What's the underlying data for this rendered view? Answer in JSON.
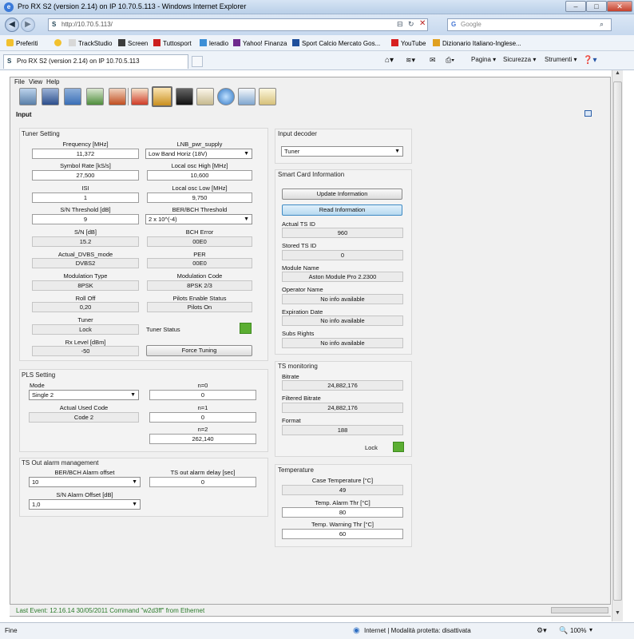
{
  "window": {
    "title": "Pro RX S2 (version 2.14) on IP 10.70.5.113 - Windows Internet Explorer"
  },
  "address": {
    "url": "http://10.70.5.113/",
    "search_placeholder": "Google"
  },
  "favorites": {
    "label": "Preferiti",
    "items": [
      "TrackStudio",
      "Screen",
      "Tuttosport",
      "leradio",
      "Yahoo! Finanza",
      "Sport Calcio Mercato Gos...",
      "YouTube",
      "Dizionario Italiano-Inglese..."
    ]
  },
  "tab": {
    "label": "Pro RX S2 (version 2.14) on IP 10.70.5.113"
  },
  "commands": {
    "page": "Pagina",
    "security": "Sicurezza",
    "tools": "Strumenti"
  },
  "app_menu": {
    "file": "File",
    "view": "View",
    "help": "Help"
  },
  "toolbar_icons": [
    "monitor-network-icon",
    "save-icon",
    "folder-icon",
    "download-icon",
    "upload-icon",
    "home-icon",
    "input-icon",
    "tv-icon",
    "clipboard-icon",
    "globe-user-icon",
    "checklist-icon",
    "edit-icon"
  ],
  "section_label": "Input",
  "tuner": {
    "title": "Tuner Setting",
    "frequency_label": "Frequency [MHz]",
    "frequency": "11,372",
    "lnb_label": "LNB_pwr_supply",
    "lnb": "Low Band Horiz (18V)",
    "symbol_rate_label": "Symbol Rate [kS/s]",
    "symbol_rate": "27,500",
    "lo_high_label": "Local osc High [MHz]",
    "lo_high": "10,600",
    "isi_label": "ISI",
    "isi": "1",
    "lo_low_label": "Local osc Low [MHz]",
    "lo_low": "9,750",
    "sn_threshold_label": "S/N Threshold [dB]",
    "sn_threshold": "9",
    "ber_threshold_label": "BER/BCH Threshold",
    "ber_threshold": "2 x 10^(-4)",
    "sn_label": "S/N [dB]",
    "sn": "15.2",
    "bch_error_label": "BCH Error",
    "bch_error": "00E0",
    "dvbs_mode_label": "Actual_DVBS_mode",
    "dvbs_mode": "DVBS2",
    "per_label": "PER",
    "per": "00E0",
    "modulation_type_label": "Modulation Type",
    "modulation_type": "8PSK",
    "modulation_code_label": "Modulation Code",
    "modulation_code": "8PSK 2/3",
    "rolloff_label": "Roll Off",
    "rolloff": "0,20",
    "pilots_label": "Pilots Enable Status",
    "pilots": "Pilots On",
    "tuner_label": "Tuner",
    "tuner_value": "Lock",
    "tuner_status_label": "Tuner Status",
    "rx_level_label": "Rx Level [dBm]",
    "rx_level": "-50",
    "force_tuning": "Force Tuning"
  },
  "pls": {
    "title": "PLS Setting",
    "mode_label": "Mode",
    "mode": "Single 2",
    "n0_label": "n=0",
    "n0": "0",
    "used_code_label": "Actual Used Code",
    "used_code": "Code 2",
    "n1_label": "n=1",
    "n1": "0",
    "n2_label": "n=2",
    "n2": "262,140"
  },
  "ts_alarm": {
    "title": "TS Out alarm management",
    "ber_offset_label": "BER/BCH Alarm offset",
    "ber_offset": "10",
    "delay_label": "TS out alarm delay [sec]",
    "delay": "0",
    "sn_offset_label": "S/N Alarm Offset [dB]",
    "sn_offset": "1,0"
  },
  "input_decoder": {
    "title": "Input decoder",
    "value": "Tuner"
  },
  "smart_card": {
    "title": "Smart Card Information",
    "update_btn": "Update Information",
    "read_btn": "Read Information",
    "actual_ts_label": "Actual TS ID",
    "actual_ts": "960",
    "stored_ts_label": "Stored TS ID",
    "stored_ts": "0",
    "module_label": "Module Name",
    "module": "Aston Module Pro 2.2300",
    "operator_label": "Operator Name",
    "operator": "No info available",
    "expiration_label": "Expiration Date",
    "expiration": "No info available",
    "subs_label": "Subs Rights",
    "subs": "No info available"
  },
  "ts_monitor": {
    "title": "TS monitoring",
    "bitrate_label": "Bitrate",
    "bitrate": "24,882,176",
    "filtered_label": "Filtered Bitrate",
    "filtered": "24,882,176",
    "format_label": "Format",
    "format": "188",
    "lock_label": "Lock"
  },
  "temperature": {
    "title": "Temperature",
    "case_label": "Case Temperature [°C]",
    "case": "49",
    "alarm_label": "Temp. Alarm Thr [°C]",
    "alarm": "80",
    "warning_label": "Temp. Warning Thr [°C]",
    "warning": "60"
  },
  "last_event": "Last Event: 12.16.14   30/05/2011 Command \"w2d3ff\" from Ethernet",
  "ie_status": {
    "left": "Fine",
    "zone": "Internet | Modalità protetta: disattivata",
    "zoom": "100%"
  },
  "colors": {
    "status_ok": "#5bae32",
    "event_text": "#2a7a2a"
  }
}
